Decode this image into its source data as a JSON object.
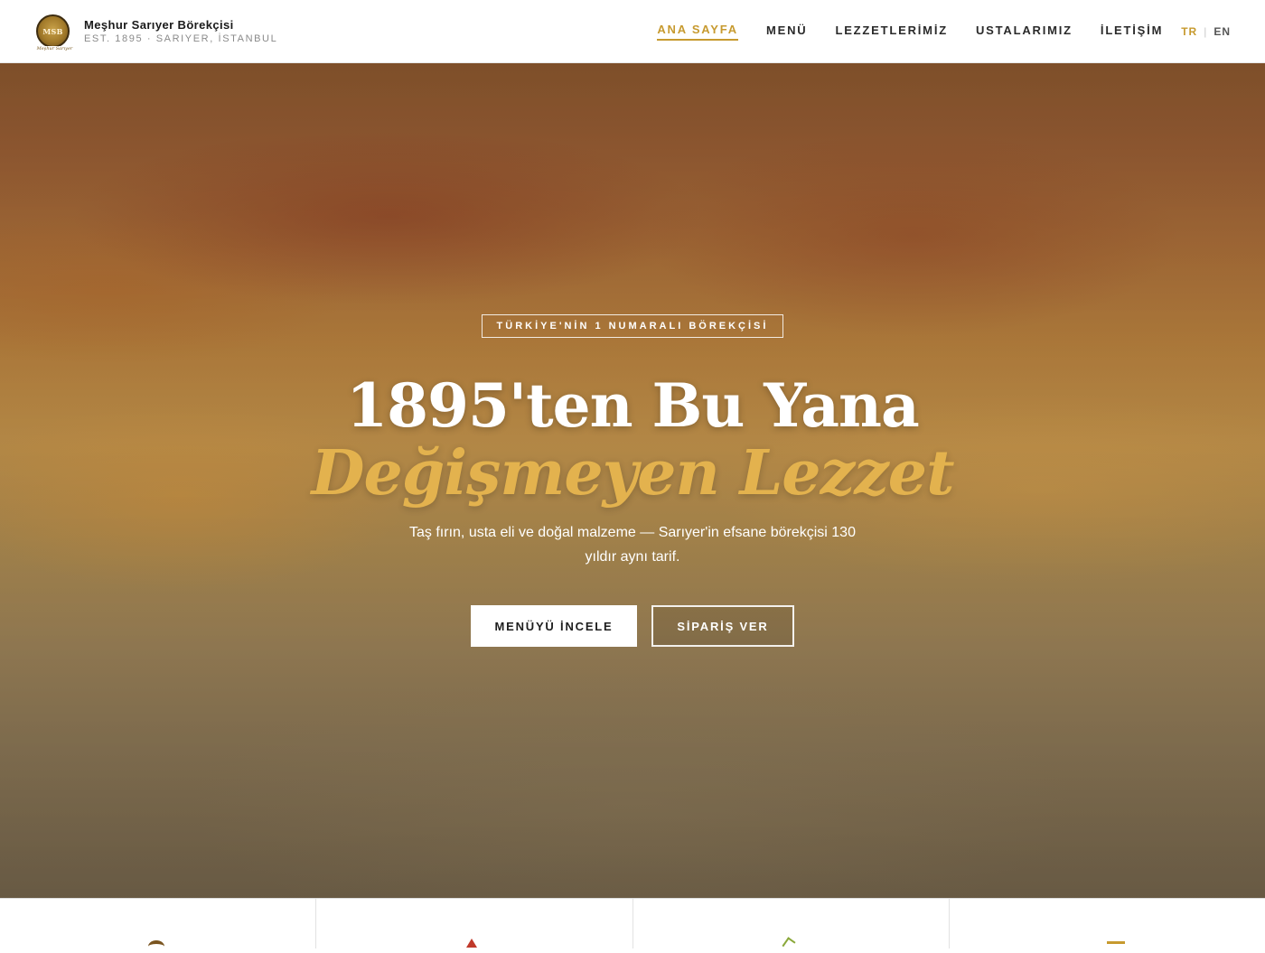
{
  "header": {
    "logo_text": "MSB",
    "logo_script": "Meşhur Sarıyer",
    "brand_name": "Meşhur Sarıyer Börekçisi",
    "brand_sub": "EST. 1895 · SARIYER, İSTANBUL",
    "nav": [
      {
        "label": "ANA SAYFA",
        "active": true
      },
      {
        "label": "MENÜ",
        "active": false
      },
      {
        "label": "LEZZETLERİMİZ",
        "active": false
      },
      {
        "label": "USTALARIMIZ",
        "active": false
      },
      {
        "label": "İLETİŞİM",
        "active": false
      }
    ],
    "lang": {
      "tr": "TR",
      "separator": "|",
      "en": "EN",
      "active": "TR"
    }
  },
  "hero": {
    "tagline": "TÜRKİYE'NİN 1 NUMARALI BÖREKÇİSİ",
    "title_line1": "1895'ten Bu Yana",
    "title_line2": "Değişmeyen Lezzet",
    "subtitle": "Taş fırın, usta eli ve doğal malzeme — Sarıyer'in efsane börekçisi 130 yıldır aynı tarif.",
    "primary_button": "MENÜYÜ İNCELE",
    "secondary_button": "SİPARİŞ VER"
  },
  "colors": {
    "accent": "#c79a2f",
    "title_gold": "#e3b24e",
    "text_dark": "#1a1a1a"
  },
  "features": {
    "icons": [
      "heritage-icon",
      "fire-icon",
      "leaf-icon",
      "tray-icon"
    ]
  }
}
